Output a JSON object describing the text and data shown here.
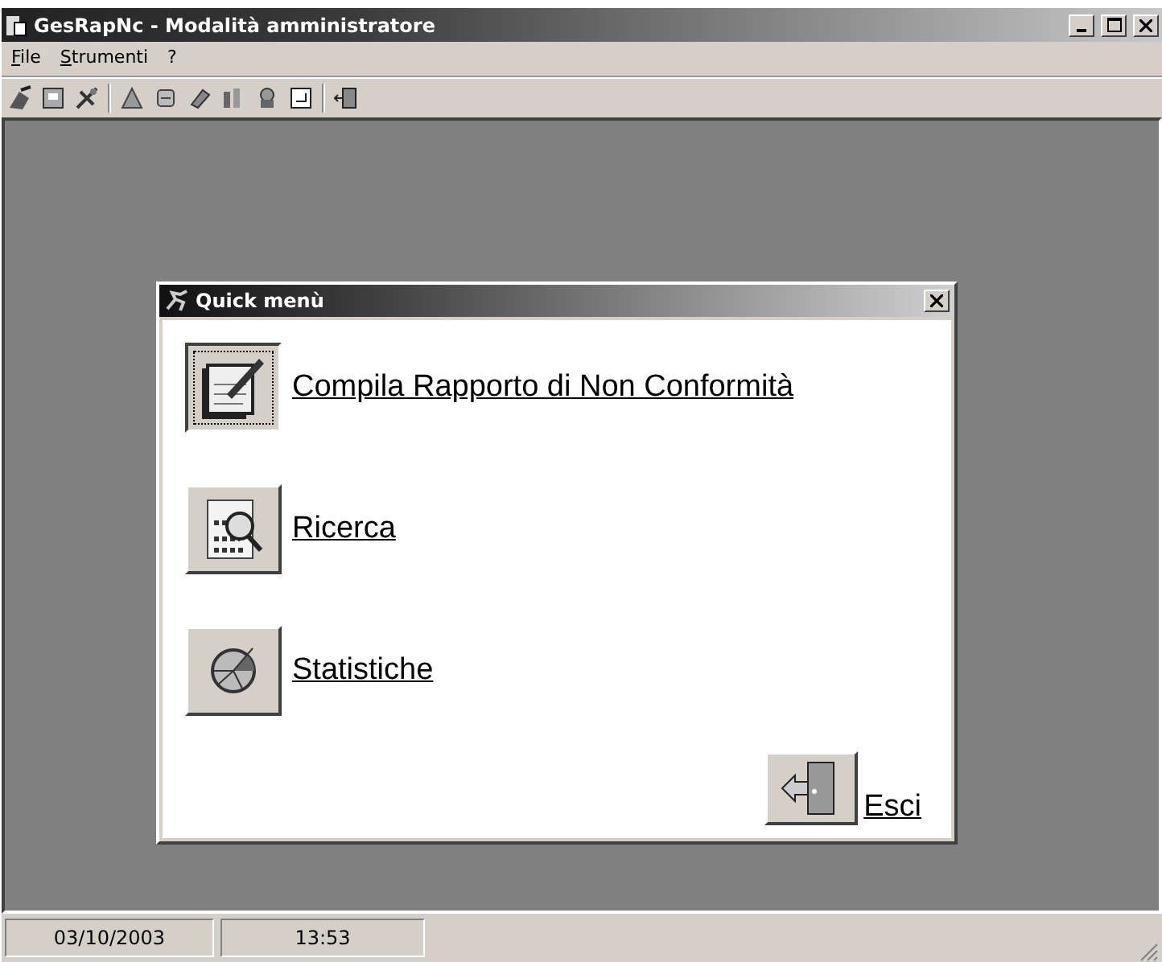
{
  "window": {
    "title": "GesRapNc - Modalità amministratore"
  },
  "menu": [
    "File",
    "Strumenti",
    "?"
  ],
  "dialog": {
    "title": "Quick menù",
    "items": [
      {
        "kind": "report",
        "label": "Compila Rapporto di Non Conformità",
        "pressed": true
      },
      {
        "kind": "search",
        "label": "Ricerca",
        "pressed": false
      },
      {
        "kind": "stats",
        "label": "Statistiche",
        "pressed": false
      }
    ],
    "exit": {
      "label": "Esci"
    }
  },
  "status_bar": [
    "03/10/2003",
    "13:53"
  ]
}
